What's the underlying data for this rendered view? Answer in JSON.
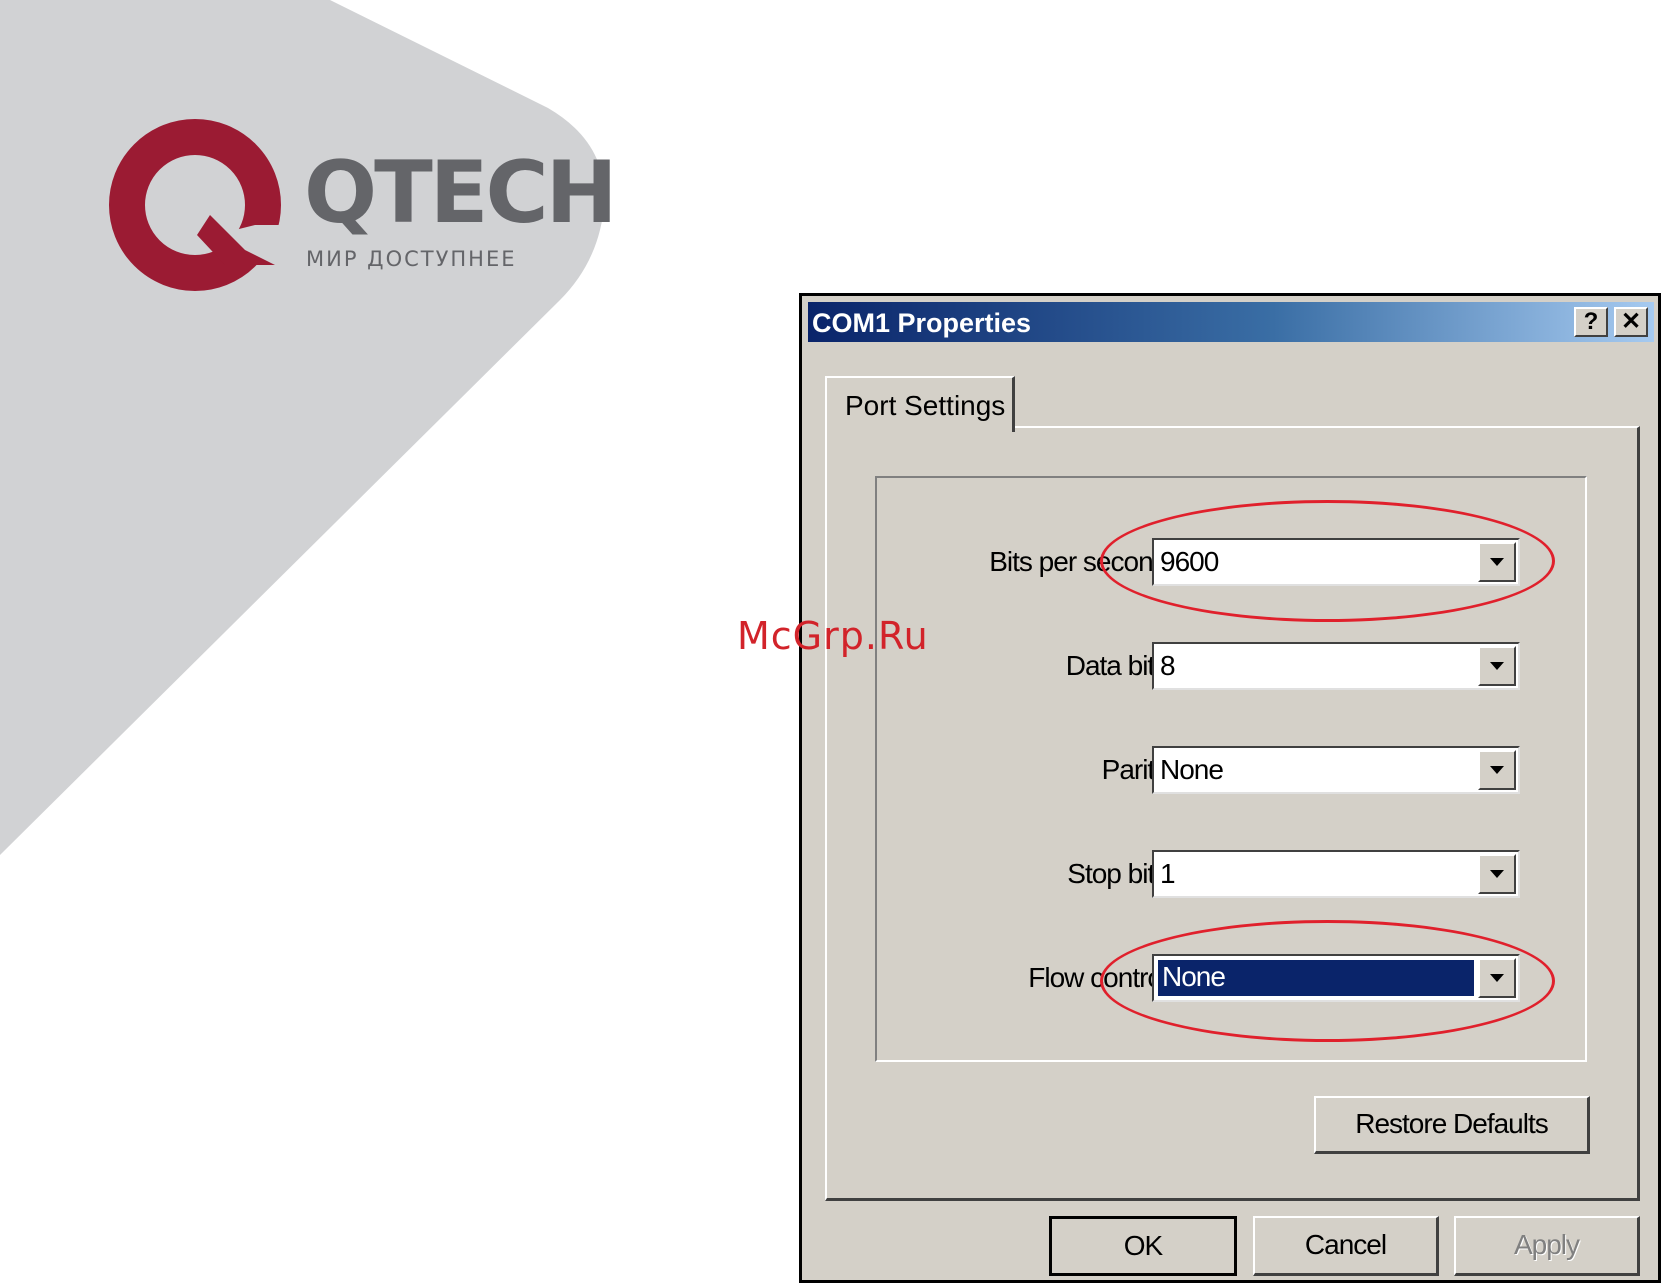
{
  "brand": {
    "wordmark": "QTECH",
    "tagline": "МИР ДОСТУПНЕЕ",
    "colors": {
      "logo_red": "#9b1b33",
      "logo_gray": "#646569",
      "background_gray": "#d1d2d4"
    }
  },
  "watermark": "McGrp.Ru",
  "dialog": {
    "title": "COM1 Properties",
    "help_label": "?",
    "close_label": "✕",
    "tab_label": "Port Settings",
    "fields": [
      {
        "label": "Bits per second:",
        "value": "9600"
      },
      {
        "label": "Data bits:",
        "value": "8"
      },
      {
        "label": "Parity:",
        "value": "None"
      },
      {
        "label": "Stop bits:",
        "value": "1"
      },
      {
        "label": "Flow control:",
        "value": "None"
      }
    ],
    "restore_defaults_label": "Restore Defaults",
    "ok_label": "OK",
    "cancel_label": "Cancel",
    "apply_label": "Apply",
    "colors": {
      "dialog_face": "#d4d0c8",
      "titlebar_start": "#0a246a",
      "highlight": "#0a246a",
      "annotation_red": "#e0202c"
    }
  }
}
